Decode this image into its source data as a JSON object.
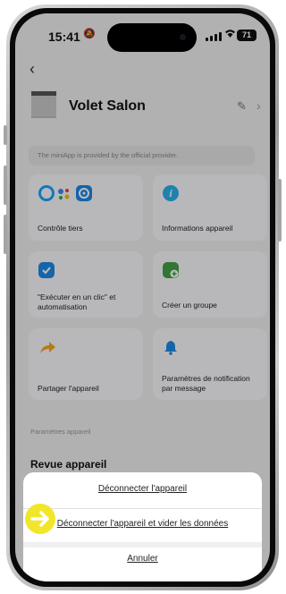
{
  "status_bar": {
    "time": "15:41",
    "battery": "71"
  },
  "header": {
    "device_name": "Volet Salon"
  },
  "notice": "The miniApp is provided by the official provider.",
  "cards": [
    {
      "label": "Contrôle tiers"
    },
    {
      "label": "Informations appareil"
    },
    {
      "label": "\"Exécuter en un clic\" et automatisation"
    },
    {
      "label": "Créer un groupe"
    },
    {
      "label": "Partager l'appareil"
    },
    {
      "label": "Paramètres de notification par message"
    }
  ],
  "section_title": "Paramètres appareil",
  "first_setting": "Revue appareil",
  "action_sheet": {
    "disconnect": "Déconnecter l'appareil",
    "disconnect_wipe": "Déconnecter l'appareil et vider les données",
    "cancel": "Annuler"
  },
  "colors": {
    "highlight": "#f2e62a",
    "accent_blue": "#1e88e5",
    "accent_green": "#4caf50",
    "accent_orange": "#f5a623"
  }
}
